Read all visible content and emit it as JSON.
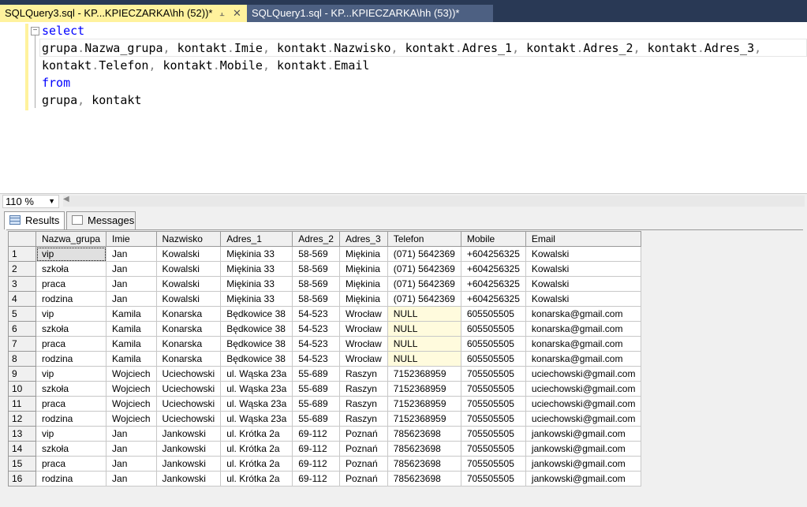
{
  "tabs": [
    {
      "label": "SQLQuery3.sql - KP...KPIECZARKA\\hh (52))*",
      "active": true
    },
    {
      "label": "SQLQuery1.sql - KP...KPIECZARKA\\hh (53))*",
      "active": false
    }
  ],
  "editor": {
    "lines": [
      [
        {
          "t": "select",
          "k": "kw"
        }
      ],
      [
        {
          "t": "grupa",
          "k": ""
        },
        {
          "t": ".",
          "k": "gray"
        },
        {
          "t": "Nazwa_grupa",
          "k": ""
        },
        {
          "t": ", ",
          "k": "gray"
        },
        {
          "t": "kontakt",
          "k": ""
        },
        {
          "t": ".",
          "k": "gray"
        },
        {
          "t": "Imie",
          "k": ""
        },
        {
          "t": ", ",
          "k": "gray"
        },
        {
          "t": "kontakt",
          "k": ""
        },
        {
          "t": ".",
          "k": "gray"
        },
        {
          "t": "Nazwisko",
          "k": ""
        },
        {
          "t": ", ",
          "k": "gray"
        },
        {
          "t": "kontakt",
          "k": ""
        },
        {
          "t": ".",
          "k": "gray"
        },
        {
          "t": "Adres_1",
          "k": ""
        },
        {
          "t": ", ",
          "k": "gray"
        },
        {
          "t": "kontakt",
          "k": ""
        },
        {
          "t": ".",
          "k": "gray"
        },
        {
          "t": "Adres_2",
          "k": ""
        },
        {
          "t": ", ",
          "k": "gray"
        },
        {
          "t": "kontakt",
          "k": ""
        },
        {
          "t": ".",
          "k": "gray"
        },
        {
          "t": "Adres_3",
          "k": ""
        },
        {
          "t": ",",
          "k": "gray"
        }
      ],
      [
        {
          "t": "kontakt",
          "k": ""
        },
        {
          "t": ".",
          "k": "gray"
        },
        {
          "t": "Telefon",
          "k": ""
        },
        {
          "t": ", ",
          "k": "gray"
        },
        {
          "t": "kontakt",
          "k": ""
        },
        {
          "t": ".",
          "k": "gray"
        },
        {
          "t": "Mobile",
          "k": ""
        },
        {
          "t": ", ",
          "k": "gray"
        },
        {
          "t": "kontakt",
          "k": ""
        },
        {
          "t": ".",
          "k": "gray"
        },
        {
          "t": "Email",
          "k": ""
        }
      ],
      [
        {
          "t": "from",
          "k": "kw"
        }
      ],
      [
        {
          "t": "grupa",
          "k": ""
        },
        {
          "t": ", ",
          "k": "gray"
        },
        {
          "t": "kontakt",
          "k": ""
        }
      ]
    ]
  },
  "zoom": "110 %",
  "result_tabs": {
    "results": "Results",
    "messages": "Messages"
  },
  "grid": {
    "columns": [
      "Nazwa_grupa",
      "Imie",
      "Nazwisko",
      "Adres_1",
      "Adres_2",
      "Adres_3",
      "Telefon",
      "Mobile",
      "Email"
    ],
    "rows": [
      [
        "vip",
        "Jan",
        "Kowalski",
        "Miękinia 33",
        "58-569",
        "Miękinia",
        "(071) 5642369",
        "+604256325",
        "Kowalski"
      ],
      [
        "szkoła",
        "Jan",
        "Kowalski",
        "Miękinia 33",
        "58-569",
        "Miękinia",
        "(071) 5642369",
        "+604256325",
        "Kowalski"
      ],
      [
        "praca",
        "Jan",
        "Kowalski",
        "Miękinia 33",
        "58-569",
        "Miękinia",
        "(071) 5642369",
        "+604256325",
        "Kowalski"
      ],
      [
        "rodzina",
        "Jan",
        "Kowalski",
        "Miękinia 33",
        "58-569",
        "Miękinia",
        "(071) 5642369",
        "+604256325",
        "Kowalski"
      ],
      [
        "vip",
        "Kamila",
        "Konarska",
        "Będkowice 38",
        "54-523",
        "Wrocław",
        "NULL",
        "605505505",
        "konarska@gmail.com"
      ],
      [
        "szkoła",
        "Kamila",
        "Konarska",
        "Będkowice 38",
        "54-523",
        "Wrocław",
        "NULL",
        "605505505",
        "konarska@gmail.com"
      ],
      [
        "praca",
        "Kamila",
        "Konarska",
        "Będkowice 38",
        "54-523",
        "Wrocław",
        "NULL",
        "605505505",
        "konarska@gmail.com"
      ],
      [
        "rodzina",
        "Kamila",
        "Konarska",
        "Będkowice 38",
        "54-523",
        "Wrocław",
        "NULL",
        "605505505",
        "konarska@gmail.com"
      ],
      [
        "vip",
        "Wojciech",
        "Uciechowski",
        "ul. Wąska 23a",
        "55-689",
        "Raszyn",
        "7152368959",
        "705505505",
        "uciechowski@gmail.com"
      ],
      [
        "szkoła",
        "Wojciech",
        "Uciechowski",
        "ul. Wąska 23a",
        "55-689",
        "Raszyn",
        "7152368959",
        "705505505",
        "uciechowski@gmail.com"
      ],
      [
        "praca",
        "Wojciech",
        "Uciechowski",
        "ul. Wąska 23a",
        "55-689",
        "Raszyn",
        "7152368959",
        "705505505",
        "uciechowski@gmail.com"
      ],
      [
        "rodzina",
        "Wojciech",
        "Uciechowski",
        "ul. Wąska 23a",
        "55-689",
        "Raszyn",
        "7152368959",
        "705505505",
        "uciechowski@gmail.com"
      ],
      [
        "vip",
        "Jan",
        "Jankowski",
        "ul. Krótka 2a",
        "69-112",
        "Poznań",
        "785623698",
        "705505505",
        "jankowski@gmail.com"
      ],
      [
        "szkoła",
        "Jan",
        "Jankowski",
        "ul. Krótka 2a",
        "69-112",
        "Poznań",
        "785623698",
        "705505505",
        "jankowski@gmail.com"
      ],
      [
        "praca",
        "Jan",
        "Jankowski",
        "ul. Krótka 2a",
        "69-112",
        "Poznań",
        "785623698",
        "705505505",
        "jankowski@gmail.com"
      ],
      [
        "rodzina",
        "Jan",
        "Jankowski",
        "ul. Krótka 2a",
        "69-112",
        "Poznań",
        "785623698",
        "705505505",
        "jankowski@gmail.com"
      ]
    ]
  },
  "colors": {
    "active_tab": "#fff29d",
    "keyword": "#0000ff",
    "null_cell": "#fffbdd"
  }
}
